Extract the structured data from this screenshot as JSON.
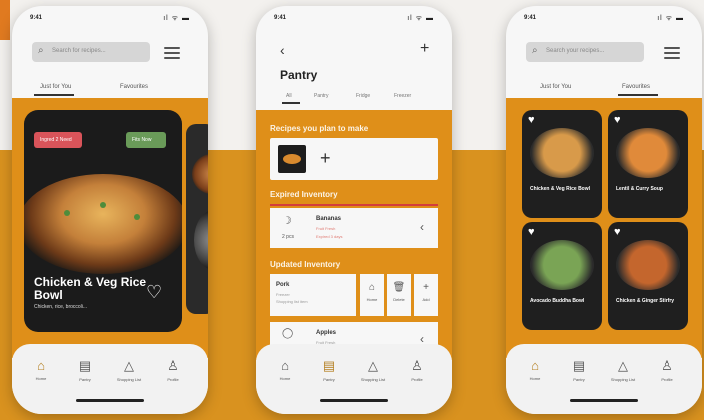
{
  "status": {
    "time": "9:41",
    "signal": "ıl ᯤ ▬"
  },
  "phone1": {
    "search_placeholder": "Search for recipes...",
    "tabs": [
      "Just for You",
      "Favourites"
    ],
    "hero": {
      "tag_red": "Ingred 2 Need",
      "tag_green": "Fits Now",
      "title": "Chicken & Veg Rice Bowl",
      "subtitle": "Chicken, rice, broccoli..."
    }
  },
  "phone2": {
    "title": "Pantry",
    "tabs": [
      "All",
      "Pantry",
      "Fridge",
      "Freezer"
    ],
    "section_plan": "Recipes you plan to make",
    "section_expired": "Expired Inventory",
    "section_updated": "Updated Inventory",
    "expired_item": {
      "qty": "2 pcs",
      "name": "Bananas",
      "line1": "Fruit Fresh",
      "line2": "Expired 3 days"
    },
    "updated_item": {
      "name": "Pork",
      "line1": "Freezer",
      "line2": "Shopping list item"
    },
    "actions": [
      "Home",
      "Delete",
      "Add"
    ],
    "updated_item2": {
      "name": "Apples",
      "line1": "Fruit Fresh"
    }
  },
  "phone3": {
    "search_placeholder": "Search your recipes...",
    "tabs": [
      "Just for You",
      "Favourites"
    ],
    "cards": [
      {
        "caption": "Chicken & Veg Rice Bowl",
        "color": "#d89a4a"
      },
      {
        "caption": "Lentil & Curry Soup",
        "color": "#e08a3a"
      },
      {
        "caption": "Avocado Buddha Bowl",
        "color": "#7aa455"
      },
      {
        "caption": "Chicken & Ginger Stirfry",
        "color": "#c4662d"
      }
    ]
  },
  "nav": [
    "Home",
    "Pantry",
    "Shopping List",
    "Profile"
  ]
}
